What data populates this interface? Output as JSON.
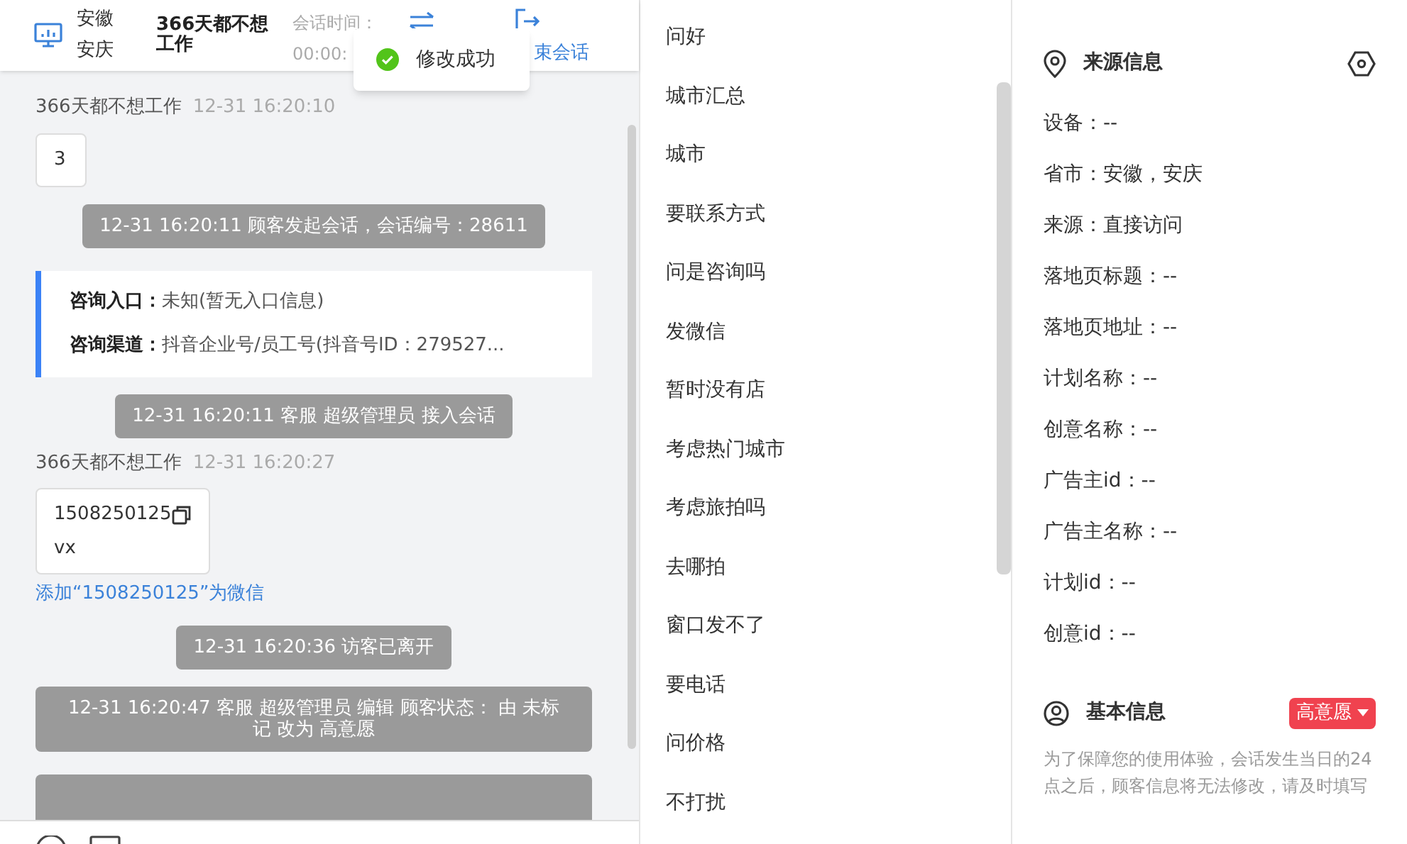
{
  "header": {
    "location": [
      "安徽",
      "安庆"
    ],
    "customer": "366天都不想工作",
    "time_label": "会话时间：",
    "time_value": "00:00:",
    "end_label": "束会话"
  },
  "toast": {
    "text": "修改成功"
  },
  "messages": [
    {
      "kind": "visitor",
      "sender": "366天都不想工作",
      "time": "12-31 16:20:10",
      "lines": [
        "3"
      ]
    },
    {
      "kind": "system",
      "text": "12-31 16:20:11 顾客发起会话，会话编号：28611"
    },
    {
      "kind": "info",
      "rows": [
        {
          "label": "咨询入口：",
          "value": "未知(暂无入口信息)"
        },
        {
          "label": "咨询渠道：",
          "value": "抖音企业号/员工号(抖音号ID：279527..."
        }
      ]
    },
    {
      "kind": "system",
      "text": "12-31 16:20:11 客服 超级管理员 接入会话"
    },
    {
      "kind": "visitor",
      "sender": "366天都不想工作",
      "time": "12-31 16:20:27",
      "lines": [
        "1508250125",
        "vx"
      ],
      "copy": true,
      "link": "添加“1508250125”为微信"
    },
    {
      "kind": "system",
      "text": "12-31 16:20:36 访客已离开"
    },
    {
      "kind": "system",
      "wide": true,
      "text": "12-31 16:20:47 客服 超级管理员 编辑 顾客状态： 由 未标记 改为 高意愿"
    }
  ],
  "quick_replies": [
    "问好",
    "城市汇总",
    "城市",
    "要联系方式",
    "问是咨询吗",
    "发微信",
    "暂时没有店",
    "考虑热门城市",
    "考虑旅拍吗",
    "去哪拍",
    "窗口发不了",
    "要电话",
    "问价格",
    "不打扰"
  ],
  "source_info": {
    "title": "来源信息",
    "rows": [
      "设备：--",
      "省市：安徽，安庆",
      "来源：直接访问",
      "落地页标题：--",
      "落地页地址：--",
      "计划名称：--",
      "创意名称：--",
      "广告主id：--",
      "广告主名称：--",
      "计划id：--",
      "创意id：--"
    ]
  },
  "basic_info": {
    "title": "基本信息",
    "status": "高意愿",
    "note": "为了保障您的使用体验，会话发生当日的24点之后，顾客信息将无法修改，请及时填写"
  }
}
